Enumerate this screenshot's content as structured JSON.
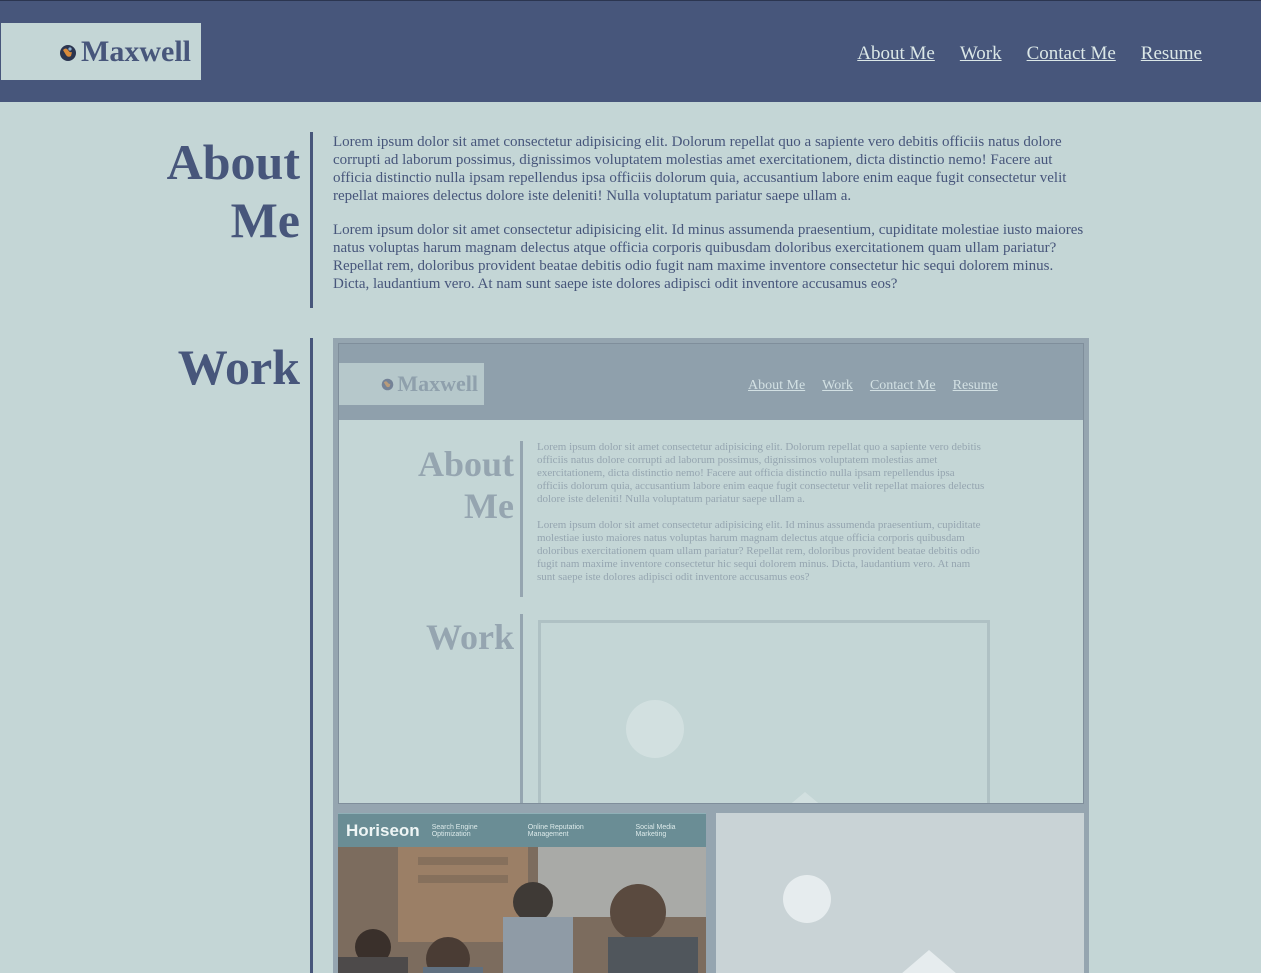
{
  "header": {
    "brand": "Maxwell",
    "brand_icon": "globe-icon",
    "nav": [
      "About Me",
      "Work",
      "Contact Me",
      "Resume"
    ]
  },
  "about": {
    "title_line1": "About",
    "title_line2": "Me",
    "paragraphs": [
      "Lorem ipsum dolor sit amet consectetur adipisicing elit. Dolorum repellat quo a sapiente vero debitis officiis natus dolore corrupti ad laborum possimus, dignissimos voluptatem molestias amet exercitationem, dicta distinctio nemo! Facere aut officia distinctio nulla ipsam repellendus ipsa officiis dolorum quia, accusantium labore enim eaque fugit consectetur velit repellat maiores delectus dolore iste deleniti! Nulla voluptatum pariatur saepe ullam a.",
      "Lorem ipsum dolor sit amet consectetur adipisicing elit. Id minus assumenda praesentium, cupiditate molestiae iusto maiores natus voluptas harum magnam delectus atque officia corporis quibusdam doloribus exercitationem quam ullam pariatur? Repellat rem, doloribus provident beatae debitis odio fugit nam maxime inventore consectetur hic sequi dolorem minus. Dicta, laudantium vero. At nam sunt saepe iste dolores adipisci odit inventore accusamus eos?"
    ]
  },
  "work": {
    "title": "Work",
    "preview": {
      "brand": "Maxwell",
      "nav": [
        "About Me",
        "Work",
        "Contact Me",
        "Resume"
      ],
      "about_title_line1": "About",
      "about_title_line2": "Me",
      "paragraph1": "Lorem ipsum dolor sit amet consectetur adipisicing elit. Dolorum repellat quo a sapiente vero debitis officiis natus dolore corrupti ad laborum possimus, dignissimos voluptatem molestias amet exercitationem, dicta distinctio nemo! Facere aut officia distinctio nulla ipsam repellendus ipsa officiis dolorum quia, accusantium labore enim eaque fugit consectetur velit repellat maiores delectus dolore iste deleniti! Nulla voluptatum pariatur saepe ullam a.",
      "paragraph2": "Lorem ipsum dolor sit amet consectetur adipisicing elit. Id minus assumenda praesentium, cupiditate molestiae iusto maiores natus voluptas harum magnam delectus atque officia corporis quibusdam doloribus exercitationem quam ullam pariatur? Repellat rem, doloribus provident beatae debitis odio fugit nam maxime inventore consectetur hic sequi dolorem minus. Dicta, laudantium vero. At nam sunt saepe iste dolores adipisci odit inventore accusamus eos?",
      "work_title": "Work"
    },
    "horiseon": {
      "logo": "Horiseon",
      "links": [
        "Search Engine Optimization",
        "Online Reputation Management",
        "Social Media Marketing"
      ]
    }
  },
  "colors": {
    "primary": "#47567b",
    "background": "#c4d6d6",
    "nav_link": "#dbe7e7"
  }
}
